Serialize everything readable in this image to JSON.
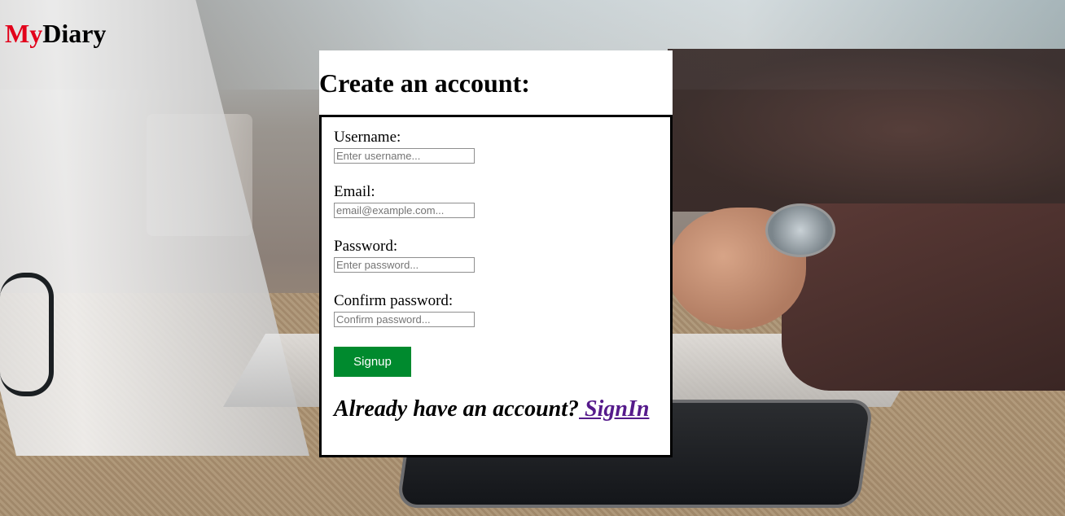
{
  "brand": {
    "part1": "My",
    "part2": "Diary",
    "part1_color": "#e2001a"
  },
  "form": {
    "heading": "Create an account:",
    "fields": [
      {
        "label": "Username:",
        "placeholder": "Enter username...",
        "value": ""
      },
      {
        "label": "Email:",
        "placeholder": "email@example.com...",
        "value": ""
      },
      {
        "label": "Password:",
        "placeholder": "Enter password...",
        "value": ""
      },
      {
        "label": "Confirm password:",
        "placeholder": "Confirm password...",
        "value": ""
      }
    ],
    "submit_label": "Signup",
    "submit_color": "#008a2e",
    "signin_prompt": "Already have an account?",
    "signin_link": " SignIn",
    "link_color": "#551a8b"
  }
}
